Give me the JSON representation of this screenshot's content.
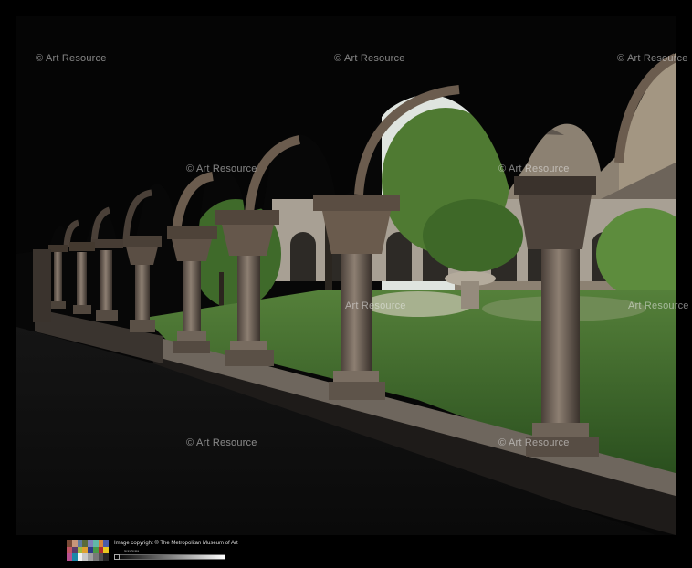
{
  "photo": {
    "subject": "cloister-arcade-photograph"
  },
  "watermarks": [
    "© Art Resource",
    "© Art Resource",
    "© Art Resource",
    "© Art Resource",
    "© Art Resource",
    "Art Resource",
    "Art Resource",
    "© Art Resource",
    "© Art Resource"
  ],
  "footer": {
    "copyright": "Image copyright © The Metropolitan Museum of Art",
    "scale_label": "Gray Scale"
  },
  "colors": {
    "background": "#000000",
    "grass": "#3b6a2c",
    "stone": "#8a7d70",
    "sky": "#e8ece8"
  }
}
